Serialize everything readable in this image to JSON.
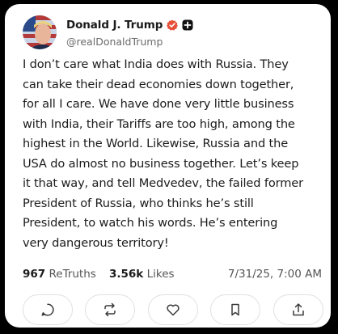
{
  "post": {
    "display_name": "Donald J. Trump",
    "handle": "@realDonaldTrump",
    "text": "I don’t care what India does with Russia. They\ncan take their dead economies down together,\nfor all I care. We have done very little business\nwith India, their Tariffs are too high, among the\nhighest in the World. Likewise, Russia and the\nUSA do almost no business together. Let’s keep\nit that way, and tell Medvedev, the failed former\nPresident of Russia, who thinks he’s still\nPresident, to watch his words. He’s entering\nvery dangerous territory!",
    "retruths_count": "967",
    "retruths_label": "ReTruths",
    "likes_count": "3.56k",
    "likes_label": "Likes",
    "timestamp": "7/31/25, 7:00 AM"
  },
  "icons": {
    "verified": "verified-badge-icon",
    "extra": "plus-badge-icon",
    "reply": "reply-icon",
    "retruth": "retruth-icon",
    "like": "heart-icon",
    "bookmark": "bookmark-icon",
    "share": "share-icon"
  },
  "colors": {
    "verified": "#e8503a",
    "background": "#000000",
    "card": "#ffffff",
    "text": "#1c1c1c",
    "muted": "#6b6b6b"
  }
}
